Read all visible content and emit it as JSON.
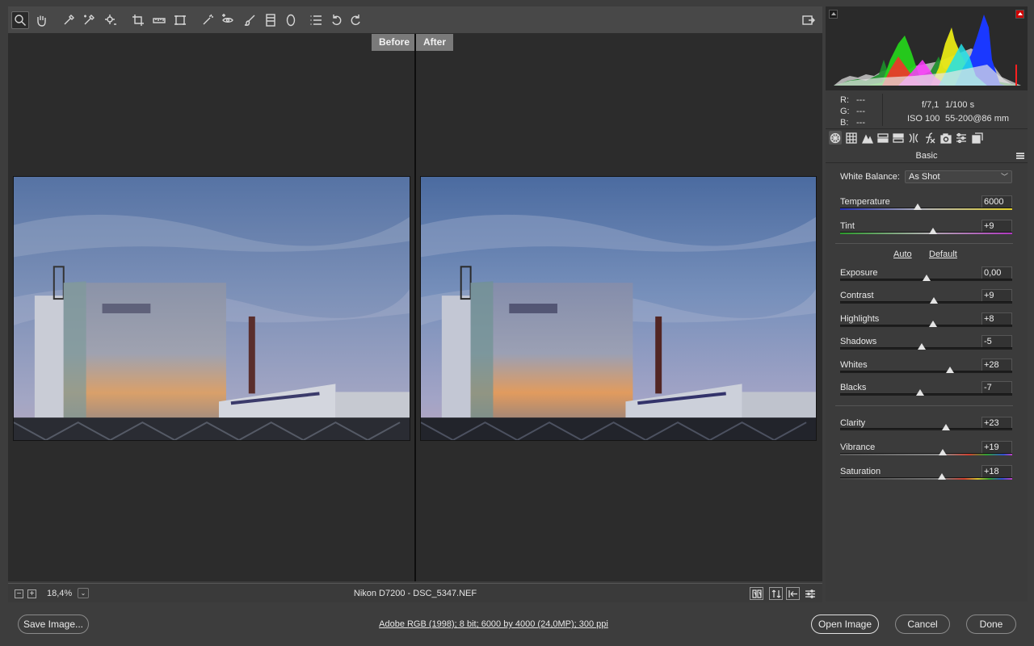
{
  "toolbar": {
    "tools": [
      "zoom-icon",
      "hand-icon",
      "white-balance-icon",
      "color-sampler-icon",
      "targeted-adjust-icon",
      "crop-icon",
      "straighten-icon",
      "transform-icon",
      "spot-removal-icon",
      "red-eye-icon",
      "adjustment-brush-icon",
      "graduated-filter-icon",
      "radial-filter-icon",
      "preferences-icon",
      "rotate-left-icon",
      "rotate-right-icon"
    ],
    "fullscreen_icon": "fullscreen-icon"
  },
  "preview": {
    "before_label": "Before",
    "after_label": "After"
  },
  "status": {
    "zoom_out": "−",
    "zoom_in": "+",
    "zoom": "18,4%",
    "zoom_dropdown": "⌄",
    "file_info": "Nikon D7200  -  DSC_5347.NEF"
  },
  "readout": {
    "r_label": "R:",
    "r_value": "---",
    "g_label": "G:",
    "g_value": "---",
    "b_label": "B:",
    "b_value": "---",
    "aperture": "f/7,1",
    "shutter": "1/100 s",
    "iso": "ISO 100",
    "lens": "55-200@86 mm"
  },
  "panel": {
    "title": "Basic",
    "white_balance_label": "White Balance:",
    "white_balance_value": "As Shot",
    "auto": "Auto",
    "default": "Default",
    "sliders": [
      {
        "key": "temperature",
        "label": "Temperature",
        "value": "6000",
        "pos": 0.45
      },
      {
        "key": "tint",
        "label": "Tint",
        "value": "+9",
        "pos": 0.54
      },
      {
        "key": "exposure",
        "label": "Exposure",
        "value": "0,00",
        "pos": 0.5
      },
      {
        "key": "contrast",
        "label": "Contrast",
        "value": "+9",
        "pos": 0.545
      },
      {
        "key": "highlights",
        "label": "Highlights",
        "value": "+8",
        "pos": 0.54
      },
      {
        "key": "shadows",
        "label": "Shadows",
        "value": "-5",
        "pos": 0.475
      },
      {
        "key": "whites",
        "label": "Whites",
        "value": "+28",
        "pos": 0.64
      },
      {
        "key": "blacks",
        "label": "Blacks",
        "value": "-7",
        "pos": 0.465
      },
      {
        "key": "clarity",
        "label": "Clarity",
        "value": "+23",
        "pos": 0.615
      },
      {
        "key": "vibrance",
        "label": "Vibrance",
        "value": "+19",
        "pos": 0.595
      },
      {
        "key": "saturation",
        "label": "Saturation",
        "value": "+18",
        "pos": 0.59
      }
    ]
  },
  "footer": {
    "save": "Save Image...",
    "info": "Adobe RGB (1998); 8 bit; 6000 by 4000 (24,0MP); 300 ppi",
    "open": "Open Image",
    "cancel": "Cancel",
    "done": "Done"
  }
}
